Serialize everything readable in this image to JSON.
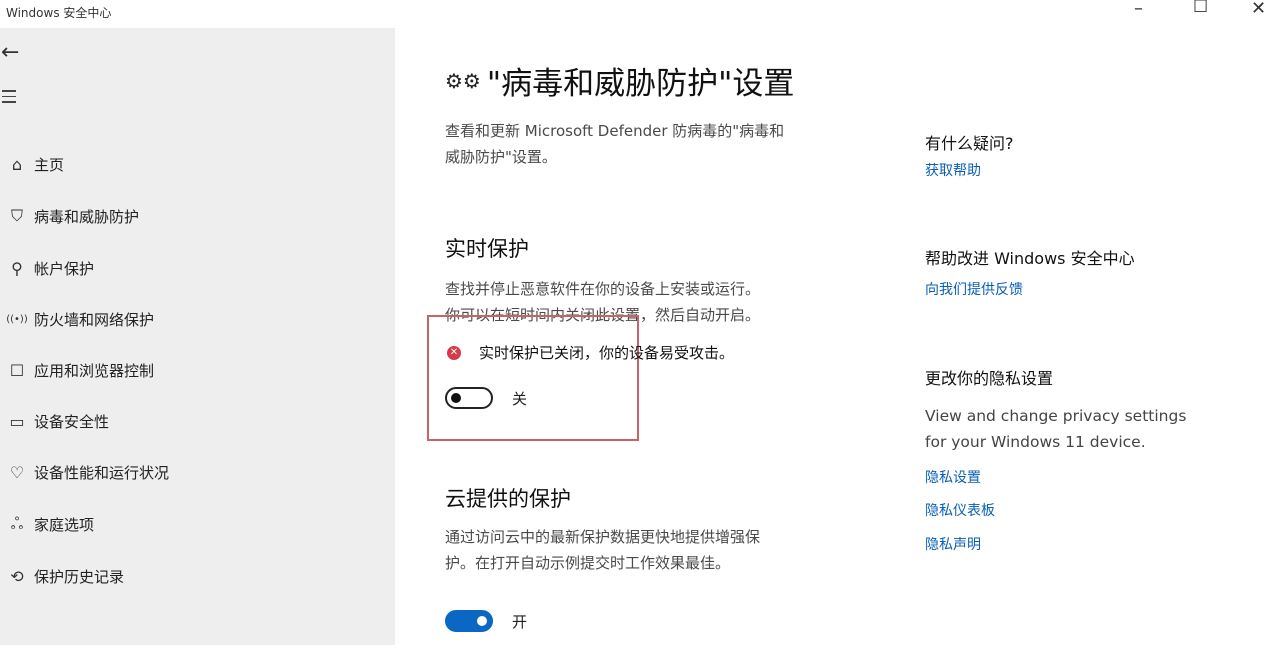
{
  "window": {
    "title": "Windows 安全中心",
    "min": "–",
    "max": "☐",
    "close": "✕"
  },
  "sidebar": {
    "back": "←",
    "items": [
      {
        "icon": "⌂",
        "label": "主页"
      },
      {
        "icon": "⛉",
        "label": "病毒和威胁防护"
      },
      {
        "icon": "⚲",
        "label": "帐户保护"
      },
      {
        "icon": "((•))",
        "label": "防火墙和网络保护"
      },
      {
        "icon": "☐",
        "label": "应用和浏览器控制"
      },
      {
        "icon": "▭",
        "label": "设备安全性"
      },
      {
        "icon": "♡",
        "label": "设备性能和运行状况"
      },
      {
        "icon": "ஃ",
        "label": "家庭选项"
      },
      {
        "icon": "⟲",
        "label": "保护历史记录"
      }
    ]
  },
  "main": {
    "gear": "⚙⚙",
    "title": "\"病毒和威胁防护\"设置",
    "description_line1": "查看和更新 Microsoft Defender 防病毒的\"病毒和",
    "description_line2": "威胁防护\"设置。",
    "realtime": {
      "heading": "实时保护",
      "line1": "查找并停止恶意软件在你的设备上安装或运行。",
      "line2": "你可以在短时间内关闭此设置，然后自动开启。",
      "alert_icon": "✕",
      "alert": "实时保护已关闭，你的设备易受攻击。",
      "toggle_label": "关",
      "toggle_on": false
    },
    "cloud": {
      "heading": "云提供的保护",
      "line1": "通过访问云中的最新保护数据更快地提供增强保",
      "line2": "护。在打开自动示例提交时工作效果最佳。",
      "toggle_label": "开",
      "toggle_on": true
    }
  },
  "right": {
    "q_heading": "有什么疑问?",
    "get_help": "获取帮助",
    "improve_heading": "帮助改进 Windows 安全中心",
    "feedback": "向我们提供反馈",
    "privacy_heading": "更改你的隐私设置",
    "privacy_desc_line1": "View and change privacy settings",
    "privacy_desc_line2": "for your Windows 11 device.",
    "privacy_settings": "隐私设置",
    "privacy_dashboard": "隐私仪表板",
    "privacy_statement": "隐私声明"
  },
  "colors": {
    "accent": "#0a68c4",
    "link": "#0a5fb5",
    "error": "#d73a49",
    "sidebar_bg": "#eeeeee",
    "highlight_box": "#c9636a"
  }
}
